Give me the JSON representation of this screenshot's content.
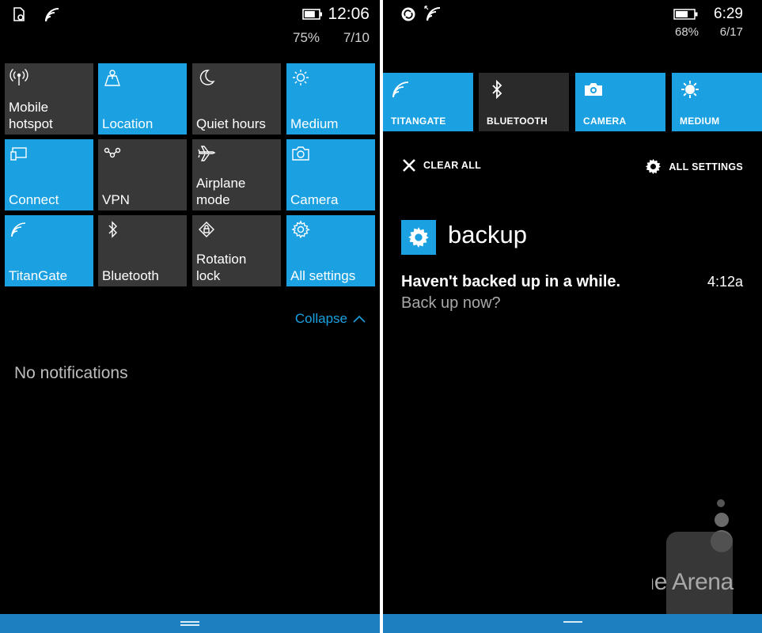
{
  "left": {
    "status": {
      "time": "12:06",
      "battery_percent": "75%",
      "date": "7/10",
      "battery_level": 0.75,
      "icons": [
        "data-sense-icon",
        "wifi-icon"
      ]
    },
    "tiles": [
      {
        "label": "Mobile\nhotspot",
        "icon": "hotspot-icon",
        "state": "off"
      },
      {
        "label": "Location",
        "icon": "location-icon",
        "state": "on"
      },
      {
        "label": "Quiet hours",
        "icon": "moon-icon",
        "state": "off"
      },
      {
        "label": "Medium",
        "icon": "brightness-icon",
        "state": "on"
      },
      {
        "label": "Connect",
        "icon": "connect-icon",
        "state": "on"
      },
      {
        "label": "VPN",
        "icon": "vpn-icon",
        "state": "off"
      },
      {
        "label": "Airplane\nmode",
        "icon": "airplane-icon",
        "state": "off"
      },
      {
        "label": "Camera",
        "icon": "camera-icon",
        "state": "on"
      },
      {
        "label": "TitanGate",
        "icon": "wifi-icon",
        "state": "on"
      },
      {
        "label": "Bluetooth",
        "icon": "bluetooth-icon",
        "state": "off"
      },
      {
        "label": "Rotation\nlock",
        "icon": "rotation-lock-icon",
        "state": "off"
      },
      {
        "label": "All settings",
        "icon": "gear-icon",
        "state": "on"
      }
    ],
    "collapse_label": "Collapse",
    "no_notifications": "No notifications"
  },
  "right": {
    "status": {
      "time": "6:29",
      "battery_percent": "68%",
      "date": "6/17",
      "battery_level": 0.68,
      "icons": [
        "sync-icon",
        "wifi-icon"
      ]
    },
    "tiles": [
      {
        "label": "TITANGATE",
        "icon": "wifi-icon",
        "state": "on"
      },
      {
        "label": "BLUETOOTH",
        "icon": "bluetooth-icon",
        "state": "off"
      },
      {
        "label": "CAMERA",
        "icon": "camera-icon",
        "state": "on"
      },
      {
        "label": "MEDIUM",
        "icon": "brightness-icon",
        "state": "on"
      }
    ],
    "clear_all": "CLEAR ALL",
    "all_settings": "ALL SETTINGS",
    "notification": {
      "app": "backup",
      "title": "Haven't backed up in a while.",
      "time": "4:12a",
      "body": "Back up now?"
    },
    "watermark": "phone Arena"
  },
  "colors": {
    "accent": "#1ba1e2",
    "tile_off": "#383838",
    "navbar": "#1d7fc0",
    "background": "#000000"
  }
}
